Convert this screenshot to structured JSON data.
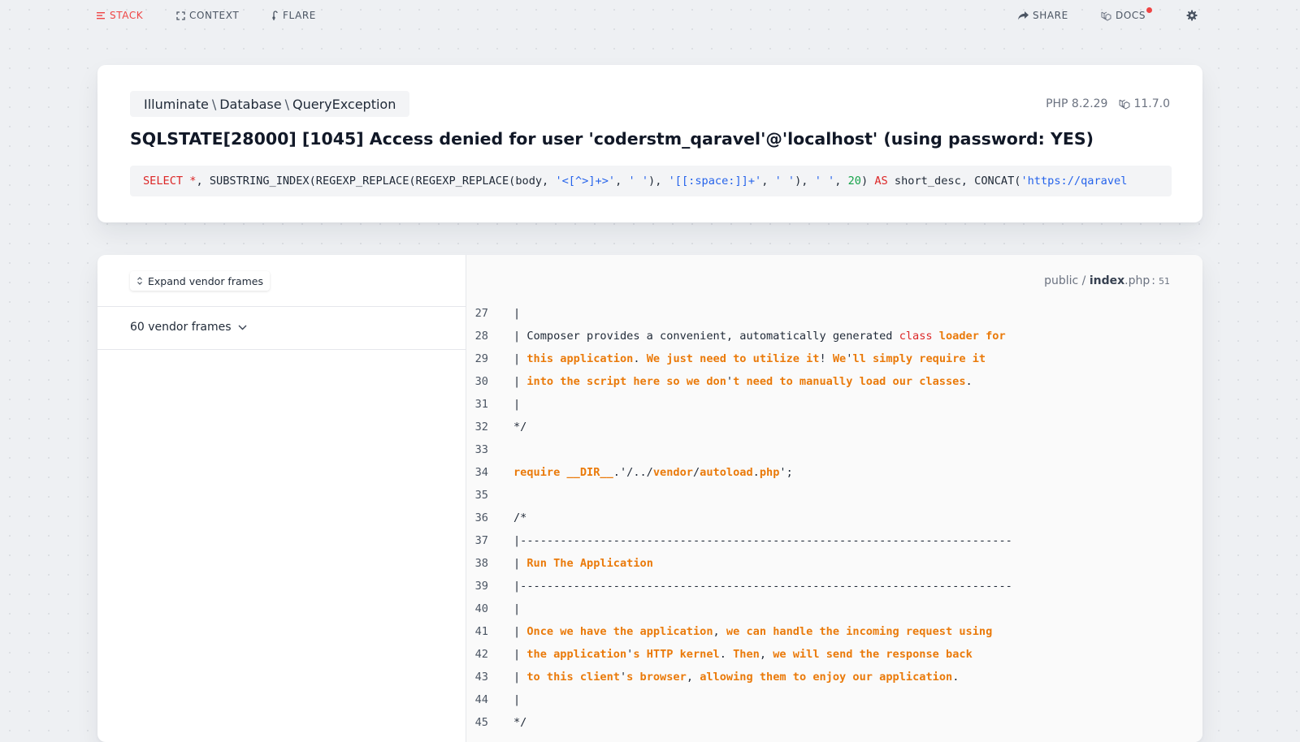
{
  "nav": {
    "stack": "STACK",
    "context": "CONTEXT",
    "flare": "FLARE",
    "share": "SHARE",
    "docs": "DOCS"
  },
  "colors": {
    "accent": "#ef4444",
    "keyword_orange": "#ea7a0a",
    "keyword_red": "#dc2626",
    "string_blue": "#2563eb",
    "number_green": "#16a34a"
  },
  "exception": {
    "class_parts": [
      "Illuminate",
      "Database",
      "QueryException"
    ],
    "class_separator": "\\",
    "php_version": "PHP 8.2.29",
    "laravel_version": "11.7.0",
    "message": "SQLSTATE[28000] [1045] Access denied for user 'coderstm_qaravel'@'localhost' (using password: YES)",
    "sql_tokens": [
      {
        "t": "SELECT",
        "c": "kw"
      },
      {
        "t": " "
      },
      {
        "t": "*",
        "c": "kw"
      },
      {
        "t": ", SUBSTRING_INDEX(REGEXP_REPLACE(REGEXP_REPLACE(body, "
      },
      {
        "t": "'<[^>]+>'",
        "c": "str"
      },
      {
        "t": ", "
      },
      {
        "t": "' '",
        "c": "str"
      },
      {
        "t": "), "
      },
      {
        "t": "'[[:space:]]+'",
        "c": "str"
      },
      {
        "t": ", "
      },
      {
        "t": "' '",
        "c": "str"
      },
      {
        "t": "), "
      },
      {
        "t": "' '",
        "c": "str"
      },
      {
        "t": ", "
      },
      {
        "t": "20",
        "c": "num"
      },
      {
        "t": ") "
      },
      {
        "t": "AS",
        "c": "kw"
      },
      {
        "t": " short_desc, CONCAT("
      },
      {
        "t": "'https://qaravel",
        "c": "str"
      }
    ]
  },
  "frames": {
    "expand_label": "Expand vendor frames",
    "vendor_frames_label": "60 vendor frames"
  },
  "file": {
    "dir": "public /",
    "name": "index",
    "ext": ".php",
    "sep": ":",
    "line": "51"
  },
  "code_lines": [
    {
      "n": "27",
      "tokens": [
        {
          "t": "|"
        }
      ]
    },
    {
      "n": "28",
      "tokens": [
        {
          "t": "| Composer provides a convenient, automatically generated "
        },
        {
          "t": "class",
          "c": "r"
        },
        {
          "t": " "
        },
        {
          "t": "loader for",
          "c": "o"
        }
      ]
    },
    {
      "n": "29",
      "tokens": [
        {
          "t": "| "
        },
        {
          "t": "this application",
          "c": "o"
        },
        {
          "t": ". "
        },
        {
          "t": "We just need to utilize it",
          "c": "o"
        },
        {
          "t": "! "
        },
        {
          "t": "We",
          "c": "o"
        },
        {
          "t": "'"
        },
        {
          "t": "ll simply require it",
          "c": "o"
        }
      ]
    },
    {
      "n": "30",
      "tokens": [
        {
          "t": "| "
        },
        {
          "t": "into the script here so we don",
          "c": "o"
        },
        {
          "t": "'"
        },
        {
          "t": "t need to manually load our classes",
          "c": "o"
        },
        {
          "t": "."
        }
      ]
    },
    {
      "n": "31",
      "tokens": [
        {
          "t": "|"
        }
      ]
    },
    {
      "n": "32",
      "tokens": [
        {
          "t": "*/"
        }
      ]
    },
    {
      "n": "33",
      "tokens": []
    },
    {
      "n": "34",
      "tokens": [
        {
          "t": "require __DIR__",
          "c": "o"
        },
        {
          "t": ".'/../"
        },
        {
          "t": "vendor",
          "c": "o"
        },
        {
          "t": "/"
        },
        {
          "t": "autoload",
          "c": "o"
        },
        {
          "t": "."
        },
        {
          "t": "php",
          "c": "o"
        },
        {
          "t": "';"
        }
      ]
    },
    {
      "n": "35",
      "tokens": []
    },
    {
      "n": "36",
      "tokens": [
        {
          "t": "/*"
        }
      ]
    },
    {
      "n": "37",
      "tokens": [
        {
          "t": "|--------------------------------------------------------------------------"
        }
      ]
    },
    {
      "n": "38",
      "tokens": [
        {
          "t": "| "
        },
        {
          "t": "Run The Application",
          "c": "o"
        }
      ]
    },
    {
      "n": "39",
      "tokens": [
        {
          "t": "|--------------------------------------------------------------------------"
        }
      ]
    },
    {
      "n": "40",
      "tokens": [
        {
          "t": "|"
        }
      ]
    },
    {
      "n": "41",
      "tokens": [
        {
          "t": "| "
        },
        {
          "t": "Once we have the application",
          "c": "o"
        },
        {
          "t": ", "
        },
        {
          "t": "we can handle the incoming request using",
          "c": "o"
        }
      ]
    },
    {
      "n": "42",
      "tokens": [
        {
          "t": "| "
        },
        {
          "t": "the application",
          "c": "o"
        },
        {
          "t": "'"
        },
        {
          "t": "s HTTP kernel",
          "c": "o"
        },
        {
          "t": ". "
        },
        {
          "t": "Then",
          "c": "o"
        },
        {
          "t": ", "
        },
        {
          "t": "we will send the response back",
          "c": "o"
        }
      ]
    },
    {
      "n": "43",
      "tokens": [
        {
          "t": "| "
        },
        {
          "t": "to this client",
          "c": "o"
        },
        {
          "t": "'"
        },
        {
          "t": "s browser",
          "c": "o"
        },
        {
          "t": ", "
        },
        {
          "t": "allowing them to enjoy our application",
          "c": "o"
        },
        {
          "t": "."
        }
      ]
    },
    {
      "n": "44",
      "tokens": [
        {
          "t": "|"
        }
      ]
    },
    {
      "n": "45",
      "tokens": [
        {
          "t": "*/"
        }
      ]
    }
  ]
}
